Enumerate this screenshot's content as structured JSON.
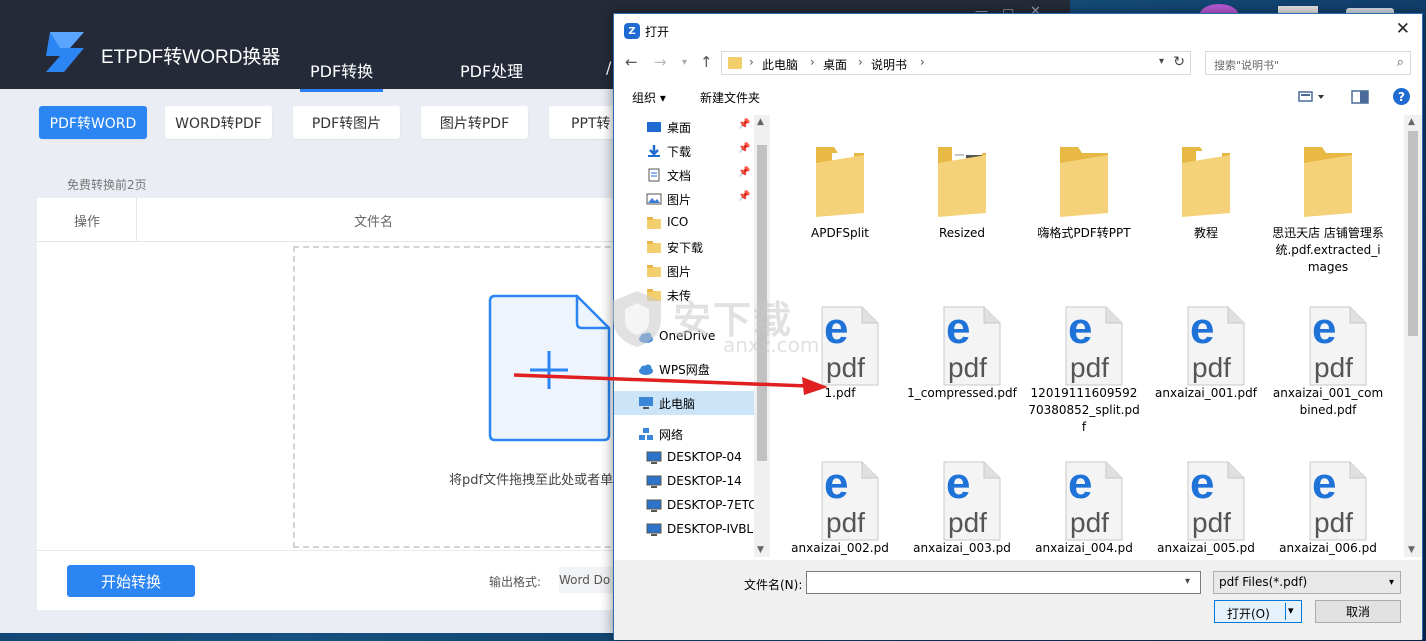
{
  "app": {
    "name": "ETPDF转WORD换器",
    "main_tabs": [
      "PDF转换",
      "PDF处理",
      "/"
    ],
    "sub_buttons": [
      "PDF转WORD",
      "WORD转PDF",
      "PDF转图片",
      "图片转PDF",
      "PPT转"
    ],
    "free_note": "免费转换前2页",
    "columns": {
      "action": "操作",
      "filename": "文件名"
    },
    "drop_text": "将pdf文件拖拽至此处或者单击",
    "start_button": "开始转换",
    "format_label": "输出格式:",
    "format_value": "Word Do",
    "window_controls": [
      "—",
      "▭",
      "✕"
    ],
    "accent_color": "#2b85f3"
  },
  "dialog": {
    "title": "打开",
    "close": "✕",
    "breadcrumbs": [
      "此电脑",
      "桌面",
      "说明书"
    ],
    "search_placeholder": "搜索\"说明书\"",
    "toolbar": {
      "organize": "组织 ▾",
      "new_folder": "新建文件夹"
    },
    "nav_items": [
      {
        "label": "桌面",
        "icon": "desktop-icon",
        "pinned": true
      },
      {
        "label": "下载",
        "icon": "download-icon",
        "pinned": true
      },
      {
        "label": "文档",
        "icon": "document-icon",
        "pinned": true
      },
      {
        "label": "图片",
        "icon": "pictures-icon",
        "pinned": true
      },
      {
        "label": "ICO",
        "icon": "folder-icon",
        "pinned": false
      },
      {
        "label": "安下载",
        "icon": "folder-icon",
        "pinned": false
      },
      {
        "label": "图片",
        "icon": "folder-icon",
        "pinned": false
      },
      {
        "label": "未传",
        "icon": "folder-icon",
        "pinned": false
      },
      {
        "label": "OneDrive",
        "icon": "cloud-icon",
        "pinned": false
      },
      {
        "label": "WPS网盘",
        "icon": "cloud-icon",
        "pinned": false
      },
      {
        "label": "此电脑",
        "icon": "computer-icon",
        "pinned": false
      },
      {
        "label": "网络",
        "icon": "network-icon",
        "pinned": false
      },
      {
        "label": "DESKTOP-04",
        "icon": "monitor-icon",
        "pinned": false
      },
      {
        "label": "DESKTOP-14",
        "icon": "monitor-icon",
        "pinned": false
      },
      {
        "label": "DESKTOP-7ETC",
        "icon": "monitor-icon",
        "pinned": false
      },
      {
        "label": "DESKTOP-IVBL",
        "icon": "monitor-icon",
        "pinned": false
      }
    ],
    "files": [
      {
        "name": "APDFSplit",
        "type": "folder"
      },
      {
        "name": "Resized",
        "type": "folder"
      },
      {
        "name": "嗨格式PDF转PPT",
        "type": "folder"
      },
      {
        "name": "教程",
        "type": "folder"
      },
      {
        "name": "思迅天店 店铺管理系统.pdf.extracted_images",
        "type": "folder"
      },
      {
        "name": "1.pdf",
        "type": "pdf"
      },
      {
        "name": "1_compressed.pdf",
        "type": "pdf"
      },
      {
        "name": "1201911160959270380852_split.pdf",
        "type": "pdf"
      },
      {
        "name": "anxaizai_001.pdf",
        "type": "pdf"
      },
      {
        "name": "anxaizai_001_combined.pdf",
        "type": "pdf"
      },
      {
        "name": "anxaizai_002.pd",
        "type": "pdf"
      },
      {
        "name": "anxaizai_003.pd",
        "type": "pdf"
      },
      {
        "name": "anxaizai_004.pd",
        "type": "pdf"
      },
      {
        "name": "anxaizai_005.pd",
        "type": "pdf"
      },
      {
        "name": "anxaizai_006.pd",
        "type": "pdf"
      }
    ],
    "pdf_icon_text": "pdf",
    "filename_label": "文件名(N):",
    "filename_value": "",
    "filetype": "pdf Files(*.pdf)",
    "open_button": "打开(O)",
    "cancel_button": "取消"
  },
  "watermark": {
    "text": "安下载",
    "sub": "anxz.com"
  }
}
